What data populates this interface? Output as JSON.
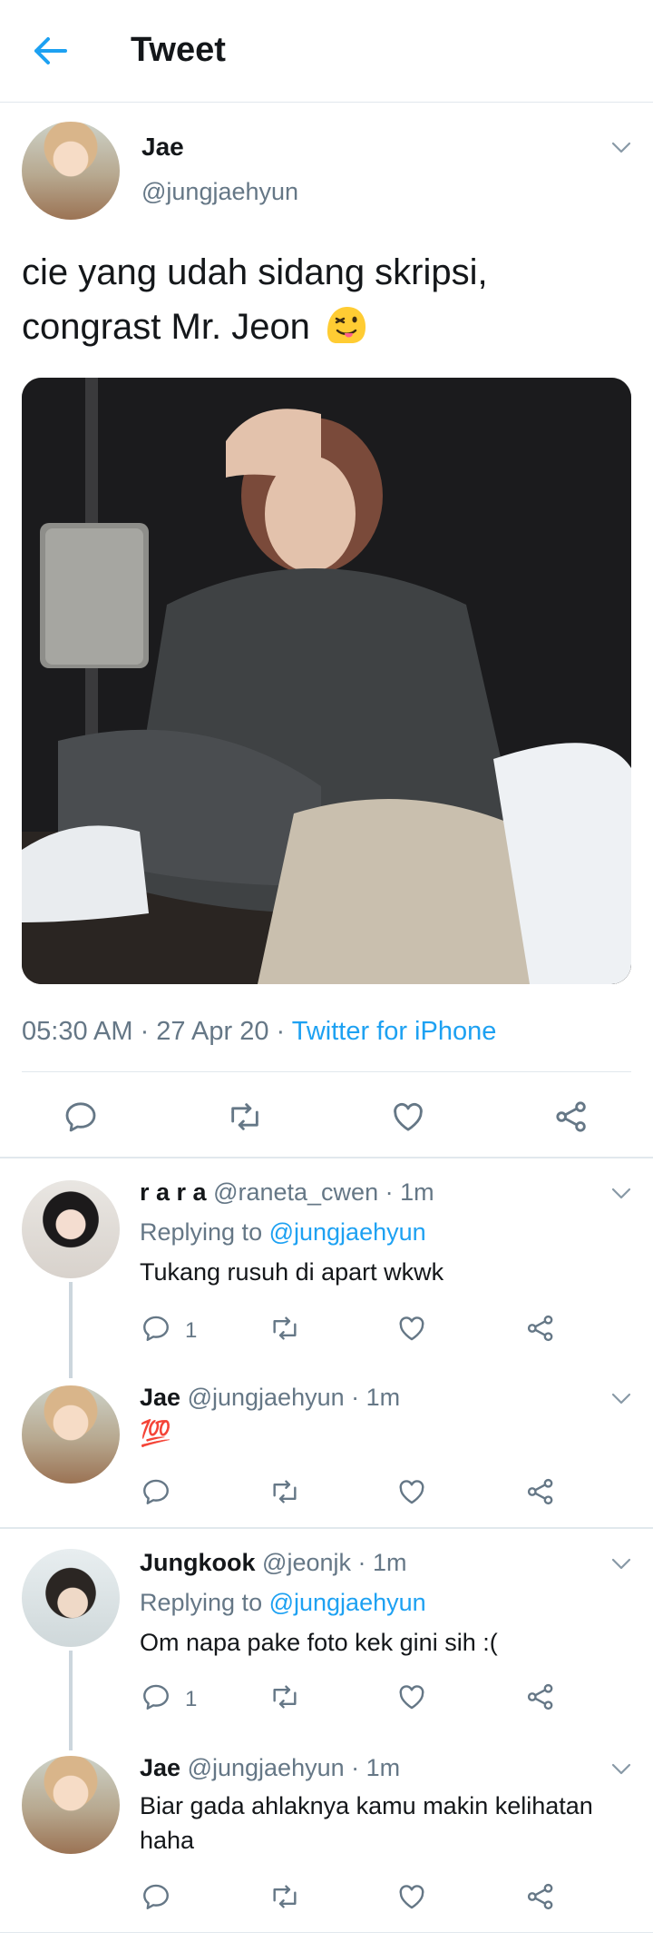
{
  "header": {
    "title": "Tweet"
  },
  "tweet": {
    "name": "Jae",
    "handle": "@jungjaehyun",
    "text": "cie yang udah sidang skripsi, congrast Mr. Jeon",
    "time": "05:30 AM · 27 Apr 20 · ",
    "source": "Twitter for iPhone"
  },
  "replies": [
    {
      "name": "r a r a",
      "handle": "@raneta_cwen · 1m",
      "replying_label": "Replying to ",
      "replying_to": "@jungjaehyun",
      "text": "Tukang rusuh di apart wkwk",
      "reply_count": "1"
    },
    {
      "name": "Jae",
      "handle": "@jungjaehyun · 1m",
      "text": "💯"
    },
    {
      "name": "Jungkook",
      "handle": "@jeonjk · 1m",
      "replying_label": "Replying to ",
      "replying_to": "@jungjaehyun",
      "text": "Om napa pake foto kek gini sih :(",
      "reply_count": "1"
    },
    {
      "name": "Jae",
      "handle": "@jungjaehyun · 1m",
      "text": "Biar gada ahlaknya kamu makin kelihatan haha"
    }
  ],
  "colors": {
    "accent": "#1da1f2",
    "secondary": "#657786",
    "divider": "#e1e8ed"
  },
  "icons": [
    "back-arrow-icon",
    "chevron-down-icon",
    "reply-icon",
    "retweet-icon",
    "like-icon",
    "share-icon",
    "winking-tongue-emoji"
  ]
}
